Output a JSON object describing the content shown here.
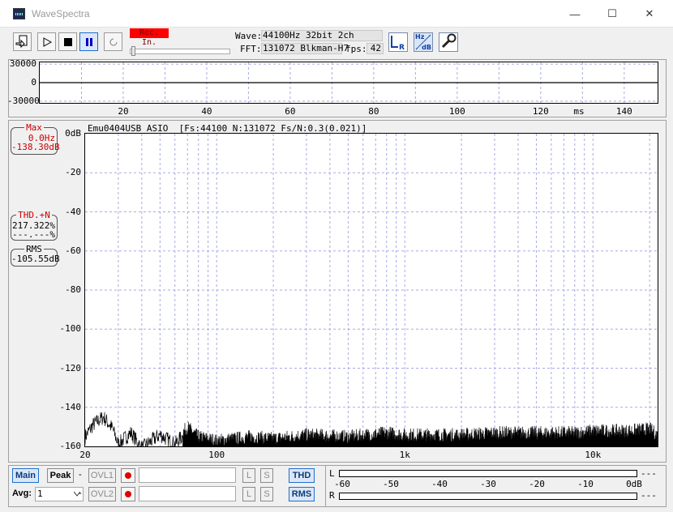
{
  "window": {
    "title": "WaveSpectra"
  },
  "window_controls": {
    "minimize": "—",
    "maximize": "☐",
    "close": "✕"
  },
  "toolbar": {
    "rec_label": "Rec. In.",
    "wave_label": "Wave:",
    "wave_value": "44100Hz 32bit 2ch",
    "fft_label": "FFT:",
    "fft_value": "131072 Blkman-H7",
    "fps_label": "fps:",
    "fps_value": "42",
    "lr_button": "LR",
    "hz_db_top": "Hz",
    "hz_db_bottom": "dB"
  },
  "wave_view": {
    "y_ticks": [
      "30000",
      "0",
      "-30000"
    ],
    "x_ticks": [
      "20",
      "40",
      "60",
      "80",
      "100",
      "120",
      "140"
    ],
    "x_unit": "ms",
    "x_range": [
      0,
      148
    ],
    "y_range": [
      -32768,
      32768
    ]
  },
  "spectrum_view": {
    "header": "Emu0404USB ASIO  [Fs:44100 N:131072 Fs/N:0.3(0.021)]",
    "y_ticks": [
      "0dB",
      "-20",
      "-40",
      "-60",
      "-80",
      "-100",
      "-120",
      "-140",
      "-160"
    ],
    "x_ticks": [
      "20",
      "100",
      "1k",
      "10k"
    ],
    "max_readout": {
      "caption": "Max",
      "freq": "0.0Hz",
      "level": "-138.30dB"
    },
    "thd_readout": {
      "caption": "THD.+N",
      "value1": "217.322%",
      "value2": "---.---%"
    },
    "rms_readout": {
      "caption": "RMS",
      "value": "-105.55dB"
    }
  },
  "chart_data": {
    "type": "line",
    "x_scale": "log",
    "xlim": [
      20,
      22050
    ],
    "ylim": [
      -160,
      0
    ],
    "ylabel": "dB",
    "noise_floor_points": [
      [
        20,
        -154
      ],
      [
        22,
        -148
      ],
      [
        25,
        -144
      ],
      [
        28,
        -150
      ],
      [
        30,
        -158
      ],
      [
        35,
        -152
      ],
      [
        40,
        -160
      ],
      [
        50,
        -153
      ],
      [
        60,
        -158
      ],
      [
        70,
        -151
      ],
      [
        80,
        -156
      ],
      [
        100,
        -158
      ],
      [
        150,
        -156
      ],
      [
        200,
        -157
      ],
      [
        300,
        -155
      ],
      [
        500,
        -156
      ],
      [
        800,
        -154
      ],
      [
        1000,
        -155
      ],
      [
        2000,
        -155
      ],
      [
        3000,
        -154
      ],
      [
        5000,
        -154
      ],
      [
        8000,
        -154
      ],
      [
        10000,
        -153
      ],
      [
        15000,
        -153
      ],
      [
        20000,
        -152
      ],
      [
        22050,
        -155
      ]
    ]
  },
  "bottom_panel": {
    "main_button": "Main",
    "peak_button": "Peak",
    "dash1": "-",
    "dash2": "-",
    "ovl1_button": "OVL1",
    "ovl2_button": "OVL2",
    "l_button": "L",
    "s_button": "S",
    "thd_button": "THD",
    "rms_button": "RMS",
    "avg_label": "Avg:",
    "avg_value": "1",
    "meter": {
      "left_channel": "L",
      "right_channel": "R",
      "ticks": [
        "-60",
        "-50",
        "-40",
        "-30",
        "-20",
        "-10",
        "0dB"
      ],
      "left_readout": "---",
      "right_readout": "---"
    }
  },
  "colors": {
    "rec_label_bg": "#ff0000",
    "readout_red": "#cc0000",
    "grid": "#a9a9e6",
    "trace": "#000000",
    "active_button": "#1e6fd0"
  }
}
